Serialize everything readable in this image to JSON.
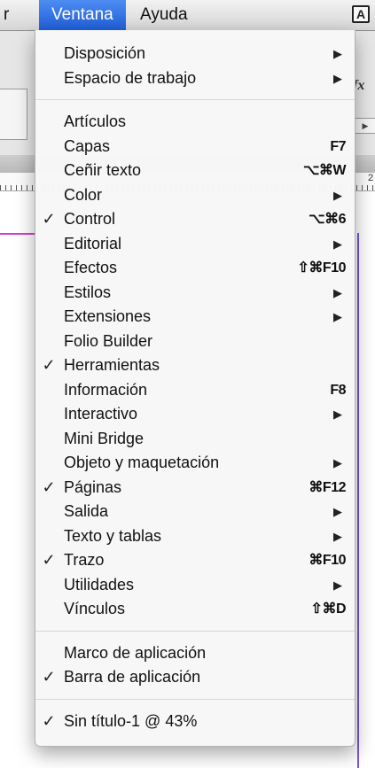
{
  "menubar": {
    "prev_item": "r",
    "active_item": "Ventana",
    "next_item": "Ayuda",
    "app_logo": "A"
  },
  "ruler": {
    "number": "2"
  },
  "panel": {
    "fx": "fx"
  },
  "menu": {
    "groups": [
      [
        {
          "label": "Disposición",
          "submenu": true
        },
        {
          "label": "Espacio de trabajo",
          "submenu": true
        }
      ],
      [
        {
          "label": "Artículos"
        },
        {
          "label": "Capas",
          "shortcut": "F7"
        },
        {
          "label": "Ceñir texto",
          "shortcut": "⌥⌘W"
        },
        {
          "label": "Color",
          "submenu": true
        },
        {
          "label": "Control",
          "checked": true,
          "shortcut": "⌥⌘6"
        },
        {
          "label": "Editorial",
          "submenu": true
        },
        {
          "label": "Efectos",
          "shortcut": "⇧⌘F10"
        },
        {
          "label": "Estilos",
          "submenu": true
        },
        {
          "label": "Extensiones",
          "submenu": true
        },
        {
          "label": "Folio Builder"
        },
        {
          "label": "Herramientas",
          "checked": true
        },
        {
          "label": "Información",
          "shortcut": "F8"
        },
        {
          "label": "Interactivo",
          "submenu": true
        },
        {
          "label": "Mini Bridge"
        },
        {
          "label": "Objeto y maquetación",
          "submenu": true
        },
        {
          "label": "Páginas",
          "checked": true,
          "shortcut": "⌘F12"
        },
        {
          "label": "Salida",
          "submenu": true
        },
        {
          "label": "Texto y tablas",
          "submenu": true
        },
        {
          "label": "Trazo",
          "checked": true,
          "shortcut": "⌘F10"
        },
        {
          "label": "Utilidades",
          "submenu": true
        },
        {
          "label": "Vínculos",
          "shortcut": "⇧⌘D"
        }
      ],
      [
        {
          "label": "Marco de aplicación"
        },
        {
          "label": "Barra de aplicación",
          "checked": true
        }
      ],
      [
        {
          "label": "Sin título-1 @ 43%",
          "checked": true
        }
      ]
    ],
    "check_glyph": "✓",
    "submenu_glyph": "▶"
  }
}
